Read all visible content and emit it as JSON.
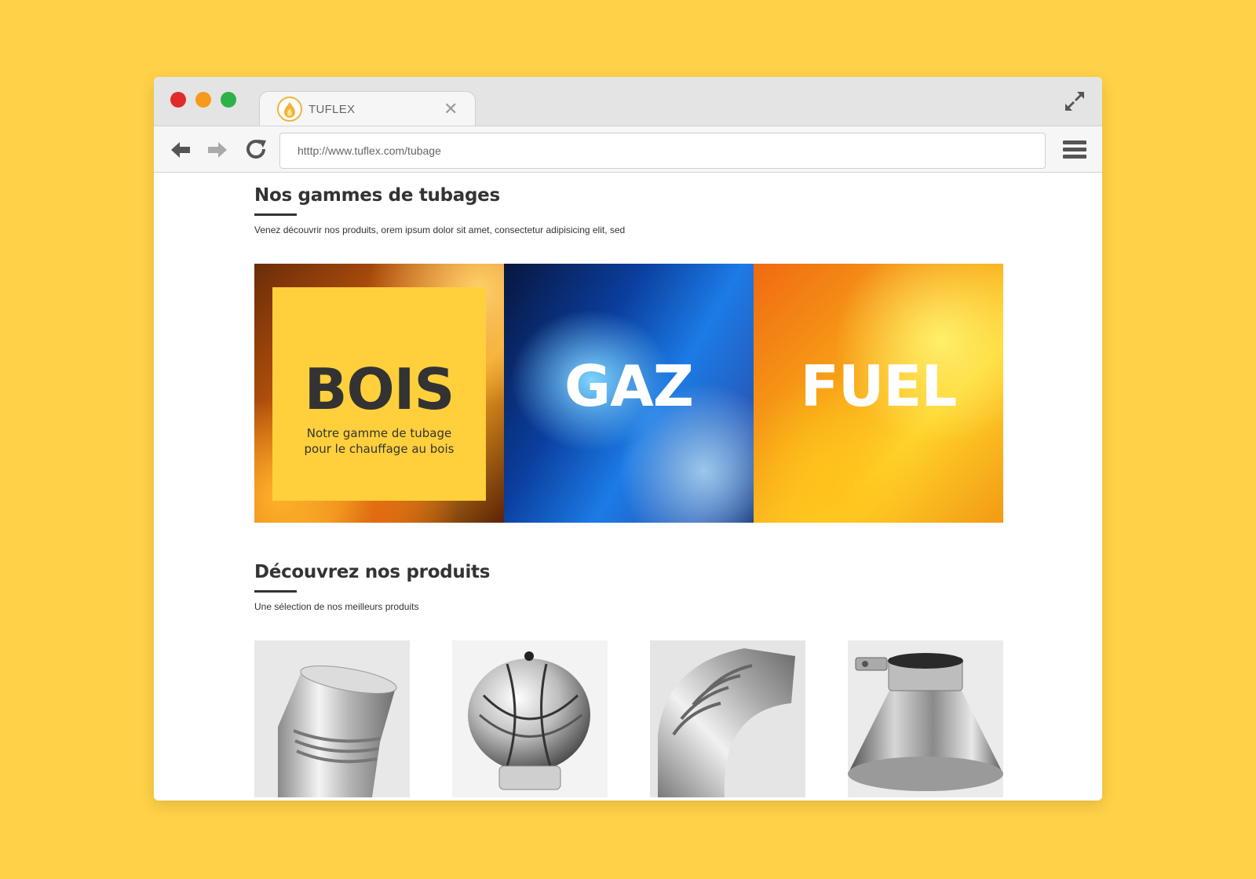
{
  "browser": {
    "tab": {
      "title": "TUFLEX",
      "favicon": "flame-logo-icon"
    },
    "url": "htttp://www.tuflex.com/tubage"
  },
  "colors": {
    "background": "#FFD147",
    "accent": "#FFD03C",
    "text": "#333333"
  },
  "section_ranges": {
    "title": "Nos gammes de tubages",
    "subtitle": "Venez découvrir nos produits, orem ipsum dolor sit amet, consectetur adipisicing elit, sed"
  },
  "categories": [
    {
      "label": "BOIS",
      "description": "Notre gamme de tubage pour le chauffage au bois"
    },
    {
      "label": "GAZ"
    },
    {
      "label": "FUEL"
    }
  ],
  "section_products": {
    "title": "Découvrez nos produits",
    "subtitle": "Une sélection de nos meilleurs produits"
  },
  "products": [
    {
      "name": "coude-45"
    },
    {
      "name": "aspirateur-rotatif"
    },
    {
      "name": "coude-90"
    },
    {
      "name": "plaque-etancheite"
    }
  ]
}
